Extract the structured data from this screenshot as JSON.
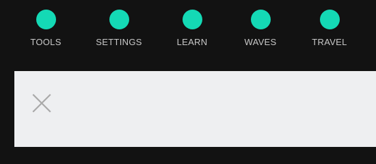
{
  "nav": {
    "accent_color": "#14d9b5",
    "items": [
      {
        "label": "TOOLS",
        "icon": "circle-icon"
      },
      {
        "label": "SETTINGS",
        "icon": "circle-icon"
      },
      {
        "label": "LEARN",
        "icon": "circle-icon"
      },
      {
        "label": "WAVES",
        "icon": "circle-icon"
      },
      {
        "label": "TRAVEL",
        "icon": "circle-icon"
      }
    ]
  },
  "panel": {
    "close_icon": "close-icon",
    "background": "#eeeff1"
  }
}
